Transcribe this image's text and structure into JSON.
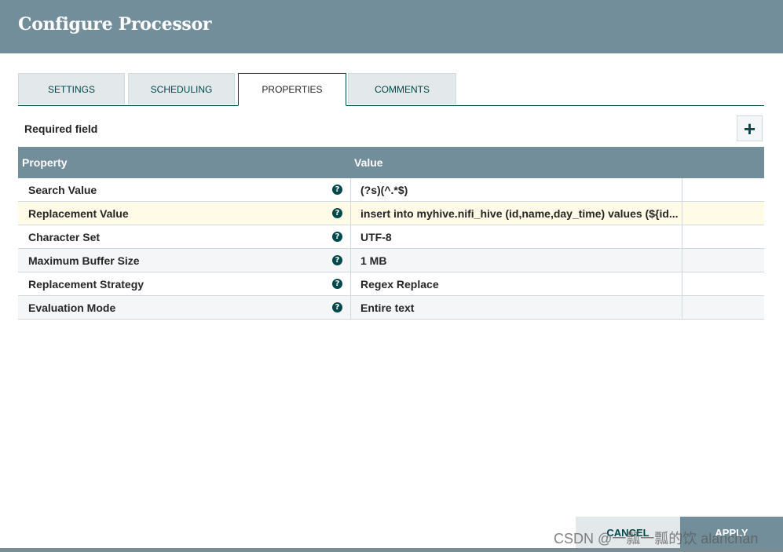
{
  "dialog": {
    "title": "Configure Processor"
  },
  "tabs": [
    {
      "label": "SETTINGS",
      "active": false
    },
    {
      "label": "SCHEDULING",
      "active": false
    },
    {
      "label": "PROPERTIES",
      "active": true
    },
    {
      "label": "COMMENTS",
      "active": false
    }
  ],
  "properties_panel": {
    "required_label": "Required field",
    "add_button_icon": "plus-icon",
    "add_button_glyph": "+",
    "columns": {
      "property": "Property",
      "value": "Value"
    },
    "rows": [
      {
        "name": "Search Value",
        "value": "(?s)(^.*$)",
        "help_icon": "question-circle-icon"
      },
      {
        "name": "Replacement Value",
        "value": "insert into myhive.nifi_hive (id,name,day_time) values (${id...",
        "help_icon": "question-circle-icon",
        "selected": true
      },
      {
        "name": "Character Set",
        "value": "UTF-8",
        "help_icon": "question-circle-icon"
      },
      {
        "name": "Maximum Buffer Size",
        "value": "1 MB",
        "help_icon": "question-circle-icon"
      },
      {
        "name": "Replacement Strategy",
        "value": "Regex Replace",
        "help_icon": "question-circle-icon"
      },
      {
        "name": "Evaluation Mode",
        "value": "Entire text",
        "help_icon": "question-circle-icon"
      }
    ],
    "help_glyph": "?"
  },
  "footer": {
    "cancel_label": "CANCEL",
    "apply_label": "APPLY"
  },
  "watermark": "CSDN @一瓢一瓢的饮 alanchan",
  "colors": {
    "header": "#728e9b",
    "accent": "#004849",
    "selected_row": "#fffbe6"
  }
}
